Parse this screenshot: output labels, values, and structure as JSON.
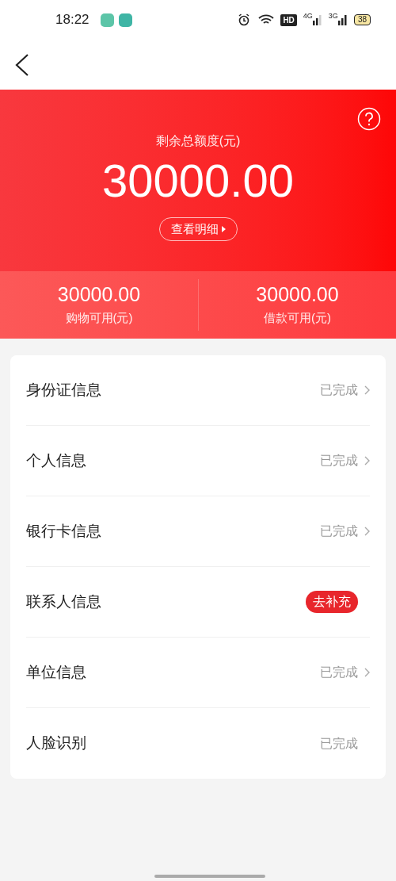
{
  "status_bar": {
    "time": "18:22",
    "hd": "HD",
    "network_1": "4G",
    "network_2": "3G",
    "battery": "38"
  },
  "summary": {
    "label": "剩余总额度(元)",
    "amount": "30000.00",
    "detail_button": "查看明细"
  },
  "sub_amounts": [
    {
      "amount": "30000.00",
      "label": "购物可用(元)"
    },
    {
      "amount": "30000.00",
      "label": "借款可用(元)"
    }
  ],
  "items": [
    {
      "label": "身份证信息",
      "kind": "done",
      "status": "已完成",
      "chevron": true
    },
    {
      "label": "个人信息",
      "kind": "done",
      "status": "已完成",
      "chevron": true
    },
    {
      "label": "银行卡信息",
      "kind": "done",
      "status": "已完成",
      "chevron": true
    },
    {
      "label": "联系人信息",
      "kind": "action",
      "status": "去补充",
      "chevron": false
    },
    {
      "label": "单位信息",
      "kind": "done",
      "status": "已完成",
      "chevron": true
    },
    {
      "label": "人脸识别",
      "kind": "done",
      "status": "已完成",
      "chevron": false
    }
  ]
}
